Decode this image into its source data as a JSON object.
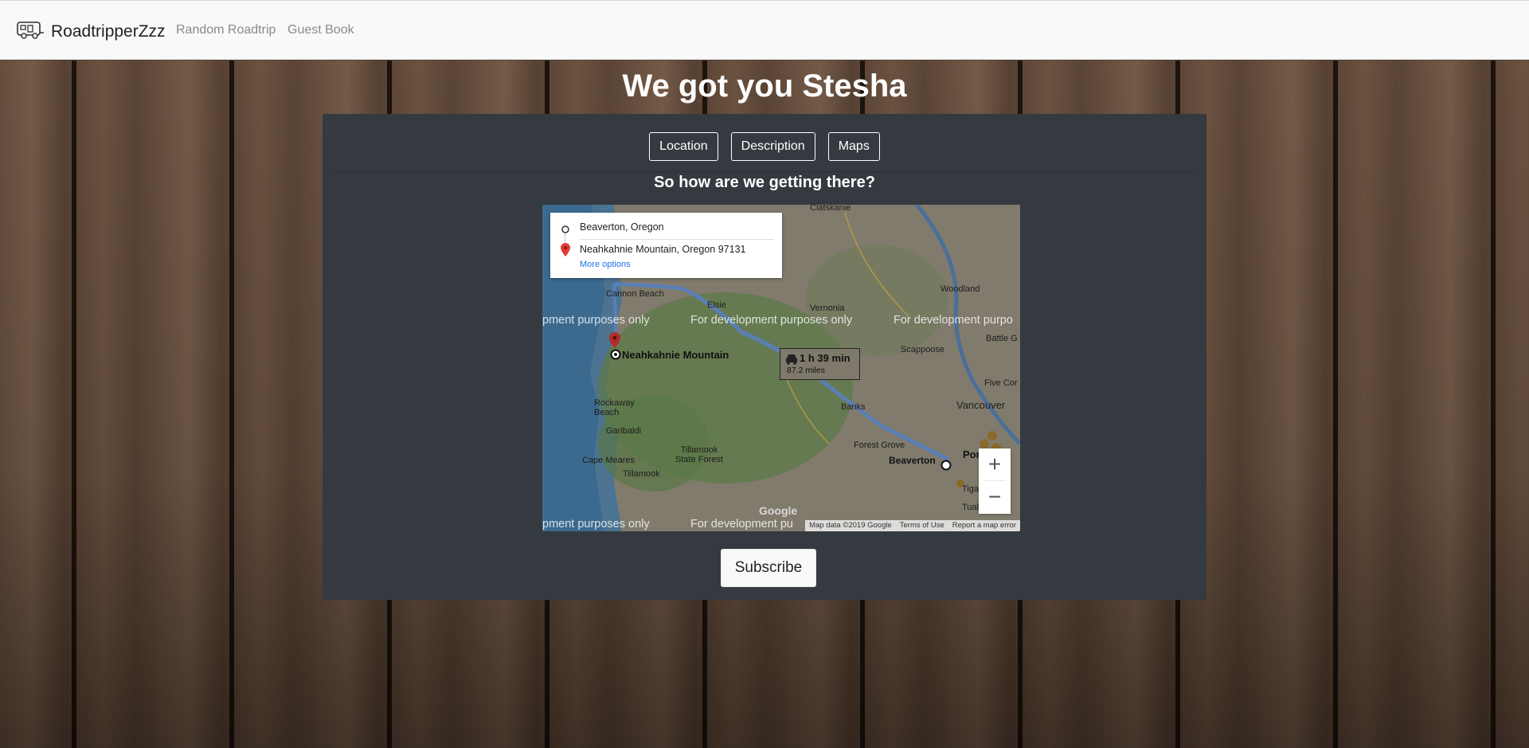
{
  "navbar": {
    "brand": "RoadtripperZzz",
    "brand_icon": "camper-icon",
    "links": [
      "Random Roadtrip",
      "Guest Book"
    ]
  },
  "page": {
    "title": "We got you Stesha",
    "tabs": [
      "Location",
      "Description",
      "Maps"
    ],
    "subtitle": "So how are we getting there?",
    "subscribe_label": "Subscribe"
  },
  "map": {
    "origin": "Beaverton, Oregon",
    "destination": "Neahkahnie Mountain, Oregon 97131",
    "more_options": "More options",
    "route_time": "1 h 39 min",
    "route_distance": "87.2 miles",
    "dev_watermark": "For development purposes only",
    "dev_watermark_partial_left": "pment purposes only",
    "dev_watermark_partial_right": "For development purpo",
    "dev_watermark_partial_bottom": "For development pu",
    "destination_label": "Neahkahnie Mountain",
    "origin_label": "Beaverton",
    "places": [
      "Clatskanie",
      "Cannon Beach",
      "Elsie",
      "Vernonia",
      "Woodland",
      "Scappoose",
      "Battle G",
      "Five Cor",
      "Vancouver",
      "Rockaway Beach",
      "Garibaldi",
      "Banks",
      "Forest Grove",
      "Tillamook State Forest",
      "Cape Meares",
      "Tillamook",
      "Tigard",
      "Tualatin",
      "Por"
    ],
    "zoom_in": "+",
    "zoom_out": "−",
    "google_logo": "Google",
    "footer": [
      "Map data ©2019 Google",
      "Terms of Use",
      "Report a map error"
    ],
    "colors": {
      "land": "#7f7a6e",
      "water": "#3d6f9a",
      "forest": "#5c7a4a",
      "route": "#5a7fb5"
    }
  }
}
